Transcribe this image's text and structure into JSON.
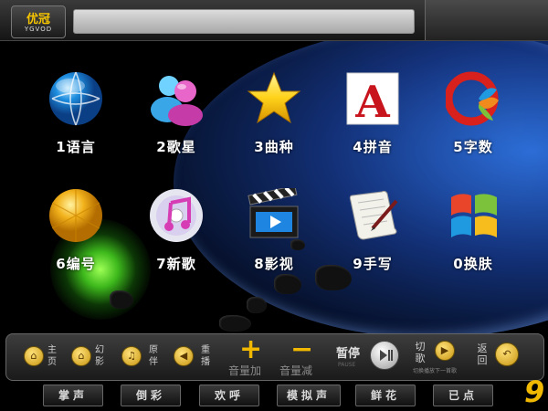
{
  "logo": {
    "title": "优冠",
    "subtitle": "YGVOD"
  },
  "search": {
    "value": ""
  },
  "menu": [
    {
      "label": "1语言",
      "icon": "globe-icon"
    },
    {
      "label": "2歌星",
      "icon": "people-icon"
    },
    {
      "label": "3曲种",
      "icon": "star-icon"
    },
    {
      "label": "4拼音",
      "icon": "letter-a-icon"
    },
    {
      "label": "5字数",
      "icon": "q-logo-icon"
    },
    {
      "label": "6编号",
      "icon": "orange-circle-icon"
    },
    {
      "label": "7新歌",
      "icon": "music-cd-icon"
    },
    {
      "label": "8影视",
      "icon": "clapperboard-icon"
    },
    {
      "label": "9手写",
      "icon": "scroll-pen-icon"
    },
    {
      "label": "0换肤",
      "icon": "windows-logo-icon"
    }
  ],
  "controls": {
    "home": "主页",
    "magic": "幻影",
    "original": "原伴",
    "replay": "重播",
    "vol_up_symbol": "+",
    "vol_down_symbol": "−",
    "vol_up": "音量加",
    "vol_down": "音量减",
    "pause": "暂停",
    "pause_sub": "PAUSE",
    "next": "切歌",
    "next_sub": "切换播放下一首歌",
    "back": "返回"
  },
  "bottom_buttons": [
    "掌声",
    "倒彩",
    "欢呼",
    "模拟声",
    "鲜花",
    "已点"
  ],
  "watermark": "9",
  "colors": {
    "accent": "#f0b800",
    "background": "#000000"
  }
}
